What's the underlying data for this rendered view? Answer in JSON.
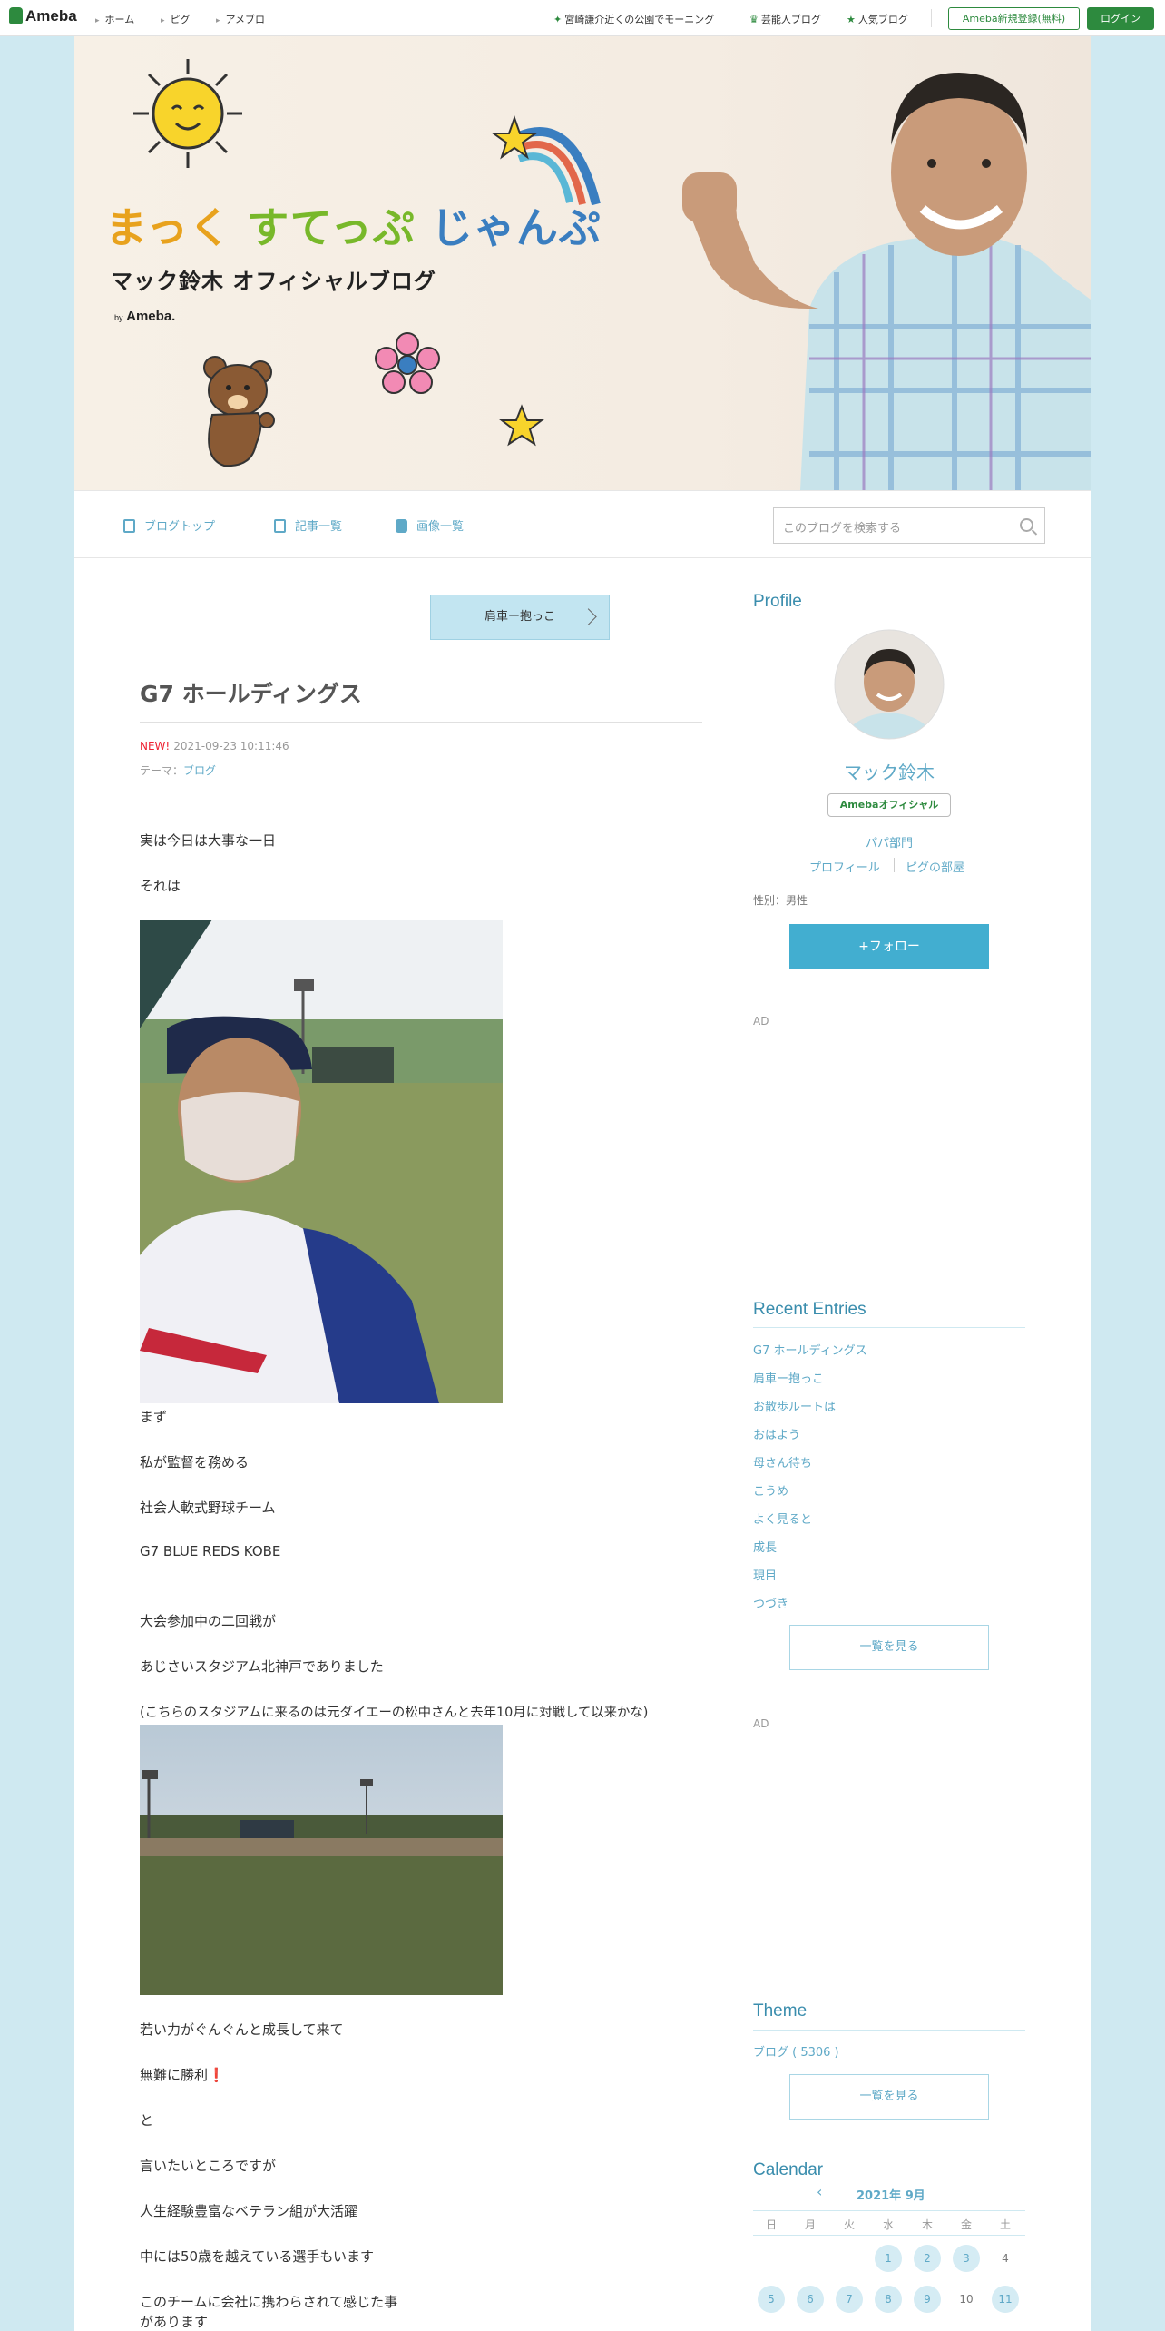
{
  "global_bar": {
    "logo": "Ameba",
    "nav": [
      "ホーム",
      "ピグ",
      "アメブロ"
    ],
    "right_links": [
      "宮崎謙介近くの公園でモーニング",
      "芸能人ブログ",
      "人気ブログ"
    ],
    "register": "Ameba新規登録(無料)",
    "login": "ログイン"
  },
  "header": {
    "title_parts": [
      "まっく",
      "すてっぷ",
      "じゃんぷ"
    ],
    "subtitle": "マック鈴木 オフィシャルブログ",
    "by": "by",
    "ameba": "Ameba."
  },
  "blog_nav": {
    "items": [
      "ブログトップ",
      "記事一覧",
      "画像一覧"
    ],
    "search_placeholder": "このブログを検索する"
  },
  "article": {
    "prev_entry": "肩車ー抱っこ",
    "title": "G7 ホールディングス",
    "new_badge": "NEW!",
    "date": "2021-09-23 10:11:46",
    "theme_label": "テーマ：",
    "theme": "ブログ",
    "paragraphs": [
      "実は今日は大事な一日",
      "それは",
      "まず",
      "私が監督を務める",
      "社会人軟式野球チーム",
      "G7 BLUE REDS KOBE",
      "大会参加中の二回戦が",
      "あじさいスタジアム北神戸でありました",
      "(こちらのスタジアムに来るのは元ダイエーの松中さんと去年10月に対戦して以来かな)",
      "若い力がぐんぐんと成長して来て",
      "無難に勝利",
      "と",
      "言いたいところですが",
      "人生経験豊富なベテラン組が大活躍",
      "中には50歳を越えている選手もいます",
      "このチームに会社に携わらされて感じた事",
      "があります"
    ],
    "exclaim": "❗"
  },
  "sidebar": {
    "profile_heading": "Profile",
    "name": "マック鈴木",
    "official_badge": "Ameba",
    "official_badge_suffix": "オフィシャル",
    "category": "パパ部門",
    "links": [
      "プロフィール",
      "ピグの部屋"
    ],
    "gender": "性別：男性",
    "follow": "+フォロー",
    "ad1": "AD",
    "recent_heading": "Recent Entries",
    "recent": [
      "G7 ホールディングス",
      "肩車ー抱っこ",
      "お散歩ルートは",
      "おはよう",
      "母さん待ち",
      "こうめ",
      "よく見ると",
      "成長",
      "現目",
      "つづき"
    ],
    "see_all": "一覧を見る",
    "ad2": "AD",
    "theme_heading": "Theme",
    "theme_item": "ブログ ( 5306 )",
    "see_all2": "一覧を見る",
    "calendar_heading": "Calendar",
    "calendar_month": "2021年 9月",
    "weekdays": [
      "日",
      "月",
      "火",
      "水",
      "木",
      "金",
      "土"
    ],
    "week1": [
      "1",
      "2",
      "3",
      "4"
    ],
    "week2": [
      "5",
      "6",
      "7",
      "8",
      "9",
      "10",
      "11"
    ]
  },
  "colors": {
    "accent": "#5fa9c7",
    "ameba_green": "#2d8a3e",
    "background": "#cfe9f1"
  }
}
